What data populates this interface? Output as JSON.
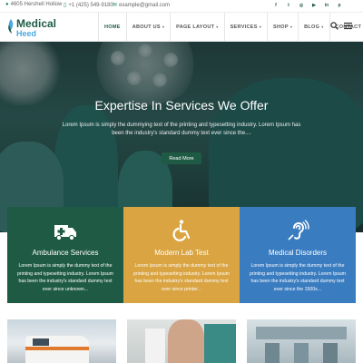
{
  "topbar": {
    "address": "4605 Hershell Hollow",
    "phone": "+1 (425) 549-9180",
    "email": "example@gmail.com",
    "social_icons": [
      "facebook-icon",
      "twitter-icon",
      "instagram-icon",
      "youtube-icon",
      "linkedin-icon",
      "pinterest-icon"
    ]
  },
  "brand": {
    "line1": "Medical",
    "line2": "Heed",
    "primary_color": "#1f5b44",
    "secondary_color": "#4da8e0"
  },
  "nav": {
    "items": [
      {
        "label": "HOME",
        "dropdown": false
      },
      {
        "label": "ABOUT US",
        "dropdown": true
      },
      {
        "label": "PAGE LAYOUT",
        "dropdown": true
      },
      {
        "label": "SERVICES",
        "dropdown": true
      },
      {
        "label": "SHOP",
        "dropdown": true
      },
      {
        "label": "BLOG",
        "dropdown": true
      },
      {
        "label": "CONTACT",
        "dropdown": false
      }
    ],
    "dropdown_glyph": "▾"
  },
  "hero": {
    "title": "Expertise In Services We Offer",
    "text": "Lorem Ipsum is simply the dummying text of the printing and typesetting industry. Lorem Ipsum has been the industry's standard dummy text ever since the....",
    "button": "Read More"
  },
  "services": [
    {
      "title": "Ambulance Services",
      "text": "Lorem Ipsum is simply the dummy text of the printing and typesetting industry. Lorem Ipsum has been the industry's standard dummy text ever since unknown...",
      "icon": "ambulance-icon",
      "color": "#1f5b44"
    },
    {
      "title": "Modern Lab Test",
      "text": "Lorem Ipsum is simply the dummy text of the printing and typesetting industry. Lorem Ipsum has been the industry's standard dummy text ever since printer...",
      "icon": "wheelchair-icon",
      "color": "#d9a441"
    },
    {
      "title": "Medical Disorders",
      "text": "Lorem Ipsum is simply the dummy text of the printing and typesetting industry. Lorem Ipsum has been the industry's standard dummy text ever since the 1500s...",
      "icon": "hearing-icon",
      "color": "#3a7cc0"
    }
  ]
}
